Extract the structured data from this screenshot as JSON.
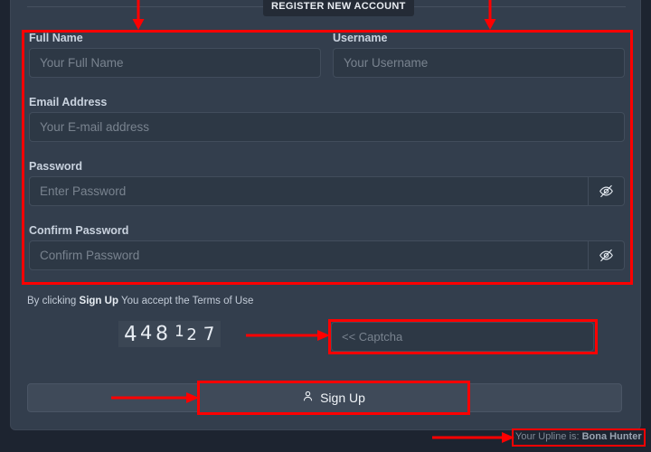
{
  "window": {
    "background_color": "#1d2430",
    "card_color": "#333e4d",
    "accent_annotation_color": "#ff0000"
  },
  "form": {
    "legend": "REGISTER NEW ACCOUNT",
    "fields": [
      {
        "label": "Full Name",
        "placeholder": "Your Full Name",
        "has_toggle": false
      },
      {
        "label": "Username",
        "placeholder": "Your Username",
        "has_toggle": false
      },
      {
        "label": "Email Address",
        "placeholder": "Your E-mail address",
        "has_toggle": false
      },
      {
        "label": "Password",
        "placeholder": "Enter Password",
        "has_toggle": true
      },
      {
        "label": "Confirm Password",
        "placeholder": "Confirm Password",
        "has_toggle": true
      }
    ],
    "terms": {
      "prefix": "By clicking ",
      "emphasis": "Sign Up",
      "suffix": " You accept the Terms of Use"
    },
    "captcha": {
      "digits": [
        "4",
        "4",
        "8",
        "1",
        "2",
        "7"
      ],
      "text": "448127",
      "input_placeholder": "<< Captcha"
    },
    "submit": {
      "label": "Sign Up",
      "icon": "user-icon"
    },
    "upline": {
      "prefix": "Your Upline is: ",
      "name": "Bona Hunter"
    }
  },
  "icons": {
    "password_toggle": "eye-off-icon",
    "submit": "user-icon"
  },
  "annotations": {
    "form_box": "highlight around all registration fields",
    "captcha_box": "highlight around captcha input",
    "signup_box": "highlight around sign up button",
    "upline_box": "highlight around upline label",
    "arrows": 4
  }
}
